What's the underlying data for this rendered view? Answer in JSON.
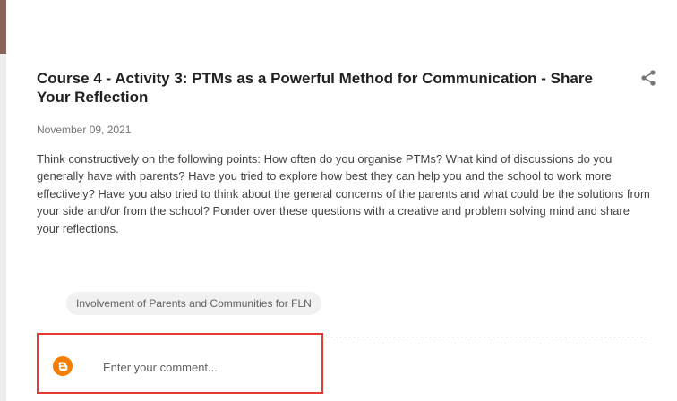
{
  "header": {
    "banner_colors": [
      "#8a6258",
      "#a27468",
      "#94807c",
      "#7f8590"
    ]
  },
  "post": {
    "title": "Course 4 - Activity 3: PTMs as a Powerful Method for Communication - Share Your Reflection",
    "date": "November 09, 2021",
    "body": " Think constructively on the following points: How often do you organise PTMs? What kind of discussions do you generally have with parents? Have you tried to explore how best they can help you and the school to work more effectively? Have you also tried to think about the general concerns of the parents and what could be the solutions from your side and/or from the school? Ponder over these questions with a creative and problem solving mind and share your reflections.",
    "share_icon": "share-icon"
  },
  "labels": {
    "items": [
      {
        "label": "Involvement of Parents and Communities for FLN"
      }
    ]
  },
  "comments": {
    "avatar_icon": "blogger-icon",
    "placeholder": "Enter your comment...",
    "value": "",
    "highlight_color": "#e53935"
  }
}
